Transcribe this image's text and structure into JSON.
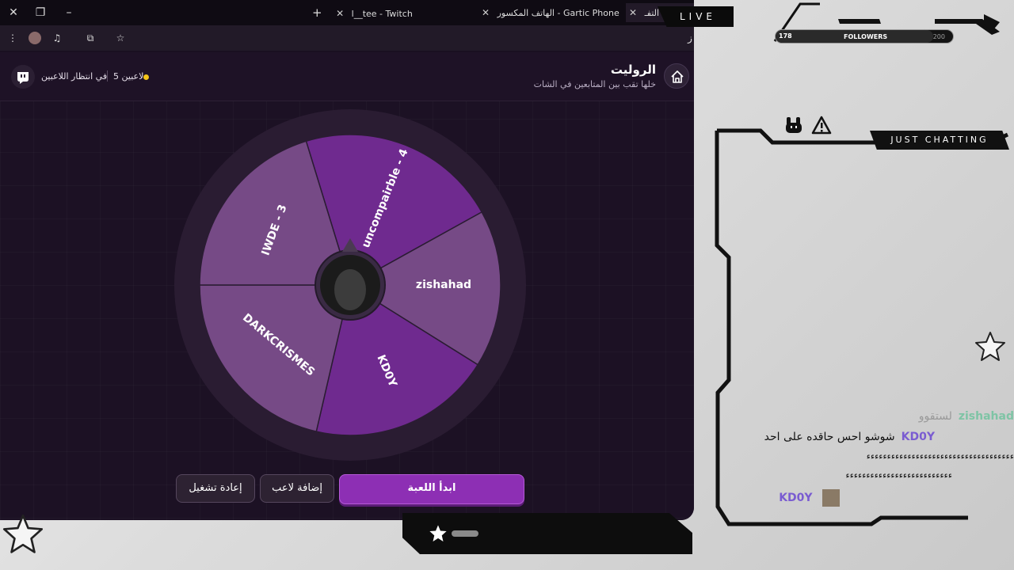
{
  "browser": {
    "tabs": [
      {
        "title": "ب التفـ",
        "active": true
      },
      {
        "title": "الهاتف المكسور - Gartic Phone",
        "active": false
      },
      {
        "title": "l__tee - Twitch",
        "active": false
      }
    ],
    "new_tab_label": "+",
    "address_text": "ز"
  },
  "app": {
    "title": "الروليت",
    "subtitle": "خلها تقب بين المتابعين في الشات",
    "status_waiting": "في انتظار اللاعبين",
    "player_count": "5 لاعبين",
    "status_dot_color": "#f5c518"
  },
  "wheel": {
    "segments": [
      {
        "label": "uncompairble - 4",
        "color": "#6f2a8f"
      },
      {
        "label": "zishahad",
        "color": "#764a86"
      },
      {
        "label": "KD0Y",
        "color": "#6f2a8f"
      },
      {
        "label": "DARKCRISMES",
        "color": "#764a86"
      },
      {
        "label": "IWDE - 3",
        "color": "#764a86"
      }
    ],
    "accent_color": "#8d2fb4"
  },
  "buttons": {
    "start": "ابدأ اللعبة",
    "add_player": "إضافة لاعب",
    "restart": "إعادة تشغيل"
  },
  "overlay": {
    "live_label": "LIVE",
    "followers_current": "178",
    "followers_label": "FOLLOWERS",
    "followers_goal": "200",
    "category": "JUST CHATTING"
  },
  "chat": {
    "messages": [
      {
        "user": "zishahad",
        "text": "لستقوو",
        "avatar": false
      },
      {
        "user": "KD0Y",
        "text": "شوشو احس حاقده على احد",
        "avatar": false
      },
      {
        "user": "",
        "text": "ءءءءءءءءءءءءءءءءءءءءءءءءءءءءءءءءءءءء",
        "avatar": false
      },
      {
        "user": "",
        "text": "ءءءءءءءءءءءءءءءءءءءءءءءءءء",
        "avatar": false
      },
      {
        "user": "KD0Y",
        "text": "",
        "avatar": true
      }
    ]
  }
}
